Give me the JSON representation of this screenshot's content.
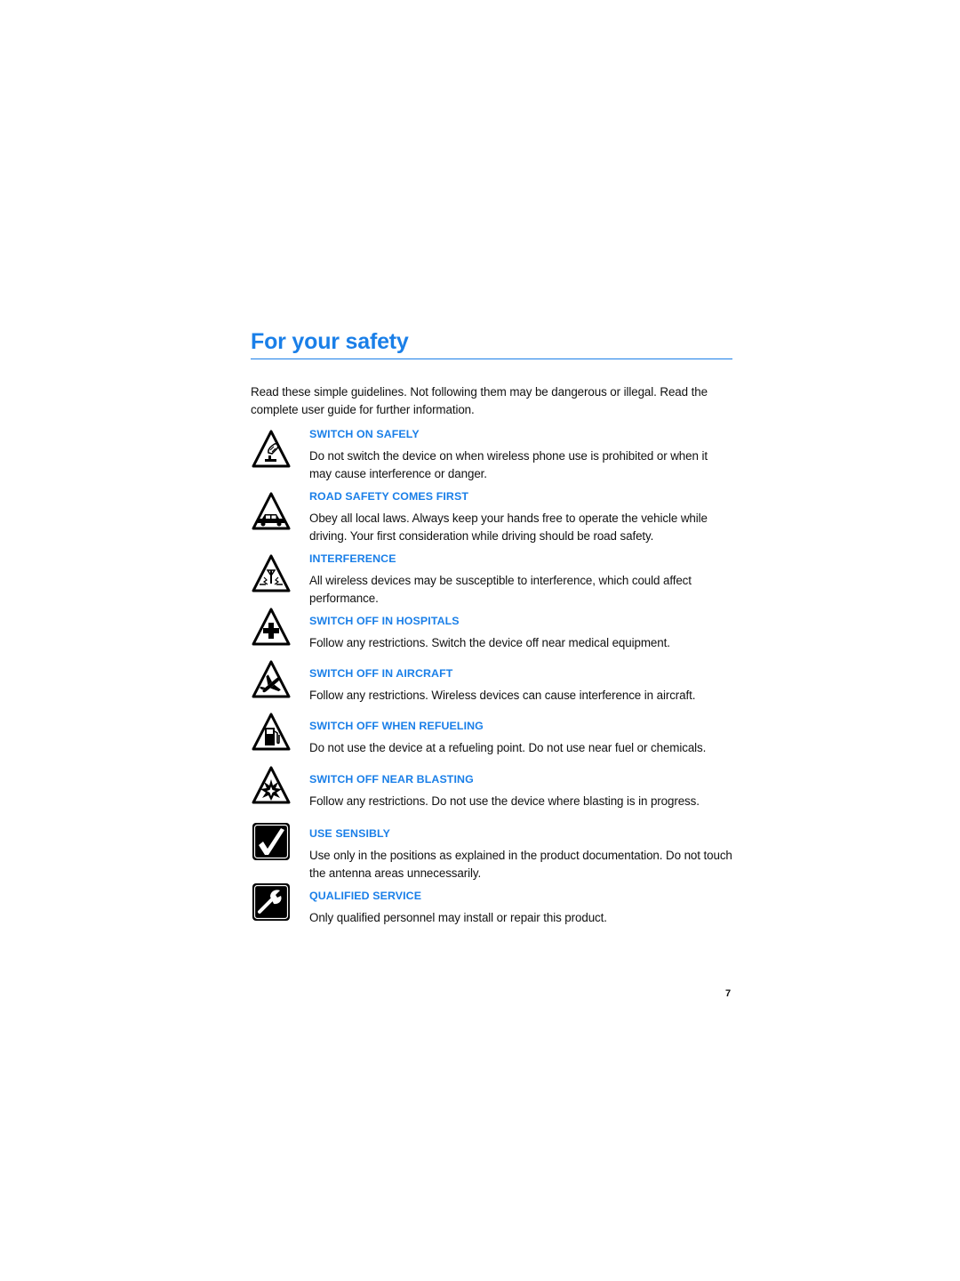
{
  "page": {
    "title": "For your safety",
    "intro": "Read these simple guidelines. Not following them may be dangerous or illegal. Read the complete user guide for further information.",
    "page_number": "7",
    "accent_color": "#1a7fe8"
  },
  "items": [
    {
      "icon": "switch-on-safely-icon",
      "heading": "SWITCH ON SAFELY",
      "text": "Do not switch the device on when wireless phone use is prohibited or when it may cause interference or danger."
    },
    {
      "icon": "car-icon",
      "heading": "ROAD SAFETY COMES FIRST",
      "text": "Obey all local laws. Always keep your hands free to operate the vehicle while driving. Your first consideration while driving should be road safety."
    },
    {
      "icon": "interference-icon",
      "heading": "INTERFERENCE",
      "text": "All wireless devices may be susceptible to interference, which could affect performance."
    },
    {
      "icon": "hospital-cross-icon",
      "heading": "SWITCH OFF IN HOSPITALS",
      "text": "Follow any restrictions. Switch the device off near medical equipment."
    },
    {
      "icon": "aircraft-icon",
      "heading": "SWITCH OFF IN AIRCRAFT",
      "text": "Follow any restrictions. Wireless devices can cause interference in aircraft."
    },
    {
      "icon": "fuel-pump-icon",
      "heading": "SWITCH OFF WHEN REFUELING",
      "text": "Do not use the device at a refueling point. Do not use near fuel or chemicals."
    },
    {
      "icon": "explosion-icon",
      "heading": "SWITCH OFF NEAR BLASTING",
      "text": "Follow any restrictions. Do not use the device where blasting is in progress."
    },
    {
      "icon": "checkmark-icon",
      "heading": "USE SENSIBLY",
      "text": "Use only in the positions as explained in the product documentation. Do not touch the antenna areas unnecessarily."
    },
    {
      "icon": "wrench-icon",
      "heading": "QUALIFIED SERVICE",
      "text": "Only qualified personnel may install or repair this product."
    }
  ]
}
